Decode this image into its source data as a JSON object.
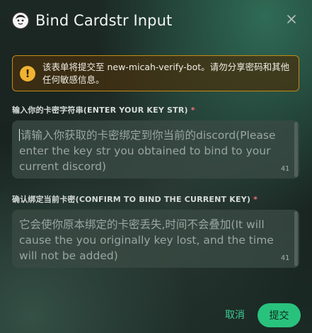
{
  "dialog": {
    "title": "Bind Cardstr Input",
    "close_icon": "close-icon",
    "avatar_icon": "avatar-icon"
  },
  "notice": {
    "icon": "warning-icon",
    "icon_glyph": "!",
    "text": "该表单将提交至 new-micah-verify-bot。请勿分享密码和其他任何敏感信息。"
  },
  "fields": [
    {
      "label": "输入你的卡密字符串(ENTER YOUR KEY STR)",
      "required_mark": "*",
      "placeholder": "请输入你获取的卡密绑定到你当前的discord(Please enter the key str you obtained to bind to your current discord)",
      "remaining": "41"
    },
    {
      "label": "确认绑定当前卡密(CONFIRM TO BIND THE CURRENT KEY)",
      "required_mark": "*",
      "placeholder": "它会使你原本绑定的卡密丢失,时间不会叠加(It will cause the you originally key lost, and the time will not be added)",
      "remaining": "41"
    }
  ],
  "footer": {
    "cancel_label": "取消",
    "submit_label": "提交"
  },
  "colors": {
    "accent": "#29c27d",
    "warning": "#f0b232",
    "required": "#f07178"
  }
}
